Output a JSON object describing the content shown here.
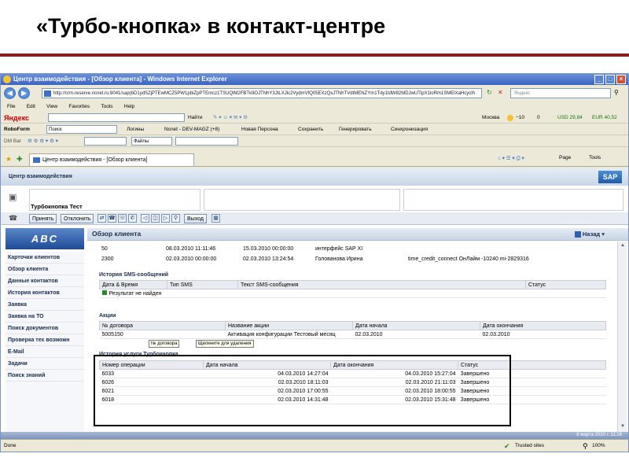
{
  "slide_title": "«Турбо-кнопка» в контакт-центре",
  "window": {
    "title": "Центр взаимодействия - [Обзор клиента] - Windows Internet Explorer",
    "buttons": [
      "_",
      "□",
      "✕"
    ]
  },
  "address": {
    "url": "http://crm-reserve.ncnet.ru:8041/sap(bD1ydSZjPTEwMCZ5PW1pbiZpPTEmcz1TSUQlM2FBTk9OJTNhY3JtLXJlc2VydmVfQ05EXzQxJTNhTVdtMENZYm1Tdy1tdW82MDJwUTlpX1loRm1SMElXaHcyclh",
    "search_placeholder": "Яндекс"
  },
  "menu": [
    "File",
    "Edit",
    "View",
    "Favorites",
    "Tools",
    "Help"
  ],
  "yandex_bar": {
    "brand": "Яндекс",
    "find_label": "Найти",
    "city": "Москва",
    "temp": "−10",
    "mail_count": "0",
    "usd": "USD 29,84",
    "eur": "EUR 40,52"
  },
  "roboform_bar": {
    "brand": "RoboForm",
    "search_value": "Поиск",
    "logins": "Логины",
    "ncnet": "Ncnet - DEV-MAGZ (+8)",
    "new_person": "Новая Персона",
    "save": "Сохранить",
    "generate": "Генерировать",
    "sync": "Синхронизация"
  },
  "dm_bar": {
    "brand": "DM Bar",
    "files": "Файлы"
  },
  "tab": {
    "label": "Центр взаимодействия - [Обзор клиента]",
    "page_menu": "Page",
    "tools_menu": "Tools"
  },
  "app": {
    "header_title": "Центр взаимодействия",
    "sap_logo": "SAP",
    "customer_name": "Турбокнопка Тест",
    "actions": {
      "accept": "Принять",
      "reject": "Отклонить",
      "exit": "Выход"
    },
    "logo_text": "ABC",
    "sidebar": [
      "Карточки клиентов",
      "Обзор клиента",
      "Данные контактов",
      "История контактов",
      "Заявка",
      "Заявка на ТО",
      "Поиск документов",
      "Проверка тех возможн",
      "E-Mail",
      "Задачи",
      "Поиск знаний"
    ],
    "main_title": "Обзор клиента",
    "back_label": "Назад"
  },
  "top_rows": [
    {
      "id": "50",
      "start": "08.03.2010 11:11:46",
      "end": "15.03.2010 00:00:00",
      "source": "интерфейс SAP XI",
      "desc": ""
    },
    {
      "id": "2300",
      "start": "02.03.2010 00:00:00",
      "end": "02.03.2010 13:24:54",
      "source": "Голованова Ирина",
      "desc": "time_credit_connect ОнЛайм -10240 mi-2829316"
    }
  ],
  "sms": {
    "title": "История SMS-сообщений",
    "headers": [
      "Дата & Время",
      "Тип SMS",
      "Текст SMS-сообщения",
      "Статус"
    ],
    "empty": "Результат не найден"
  },
  "actions_section": {
    "title": "Акции",
    "headers": [
      "№ договора",
      "Название акции",
      "Дата начала",
      "Дата окончания"
    ],
    "rows": [
      {
        "contract": "5005150",
        "name": "Активация конфигурации Тестовый месяц",
        "start": "02.03.2010",
        "end": "02.03.2010"
      }
    ],
    "tooltip_contract": "№ договора",
    "tooltip_hint": "Щелкните для удаления"
  },
  "turbo": {
    "title": "История услуги Турбокнопка",
    "headers": [
      "Номер операции",
      "Дата начала",
      "Дата окончания",
      "Статус"
    ],
    "rows": [
      {
        "op": "6033",
        "start": "04.03.2010 14:27:04",
        "end": "04.03.2010 15:27:04",
        "status": "Завершено"
      },
      {
        "op": "6026",
        "start": "02.03.2010 18:11:03",
        "end": "02.03.2010 21:11:03",
        "status": "Завершено"
      },
      {
        "op": "6021",
        "start": "02.03.2010 17:00:55",
        "end": "02.03.2010 18:00:55",
        "status": "Завершено"
      },
      {
        "op": "6018",
        "start": "02.03.2010 14:31:48",
        "end": "02.03.2010 15:31:48",
        "status": "Завершено"
      }
    ]
  },
  "status": {
    "band_date": "8 марта 2010 г. 11:16",
    "left": "Done",
    "trusted": "Trusted sites",
    "zoom": "100%"
  },
  "colors": {
    "title_rule": "#8b1c1c",
    "ie_title": "#3a64c4",
    "sap_blue": "#1f5ba8"
  }
}
